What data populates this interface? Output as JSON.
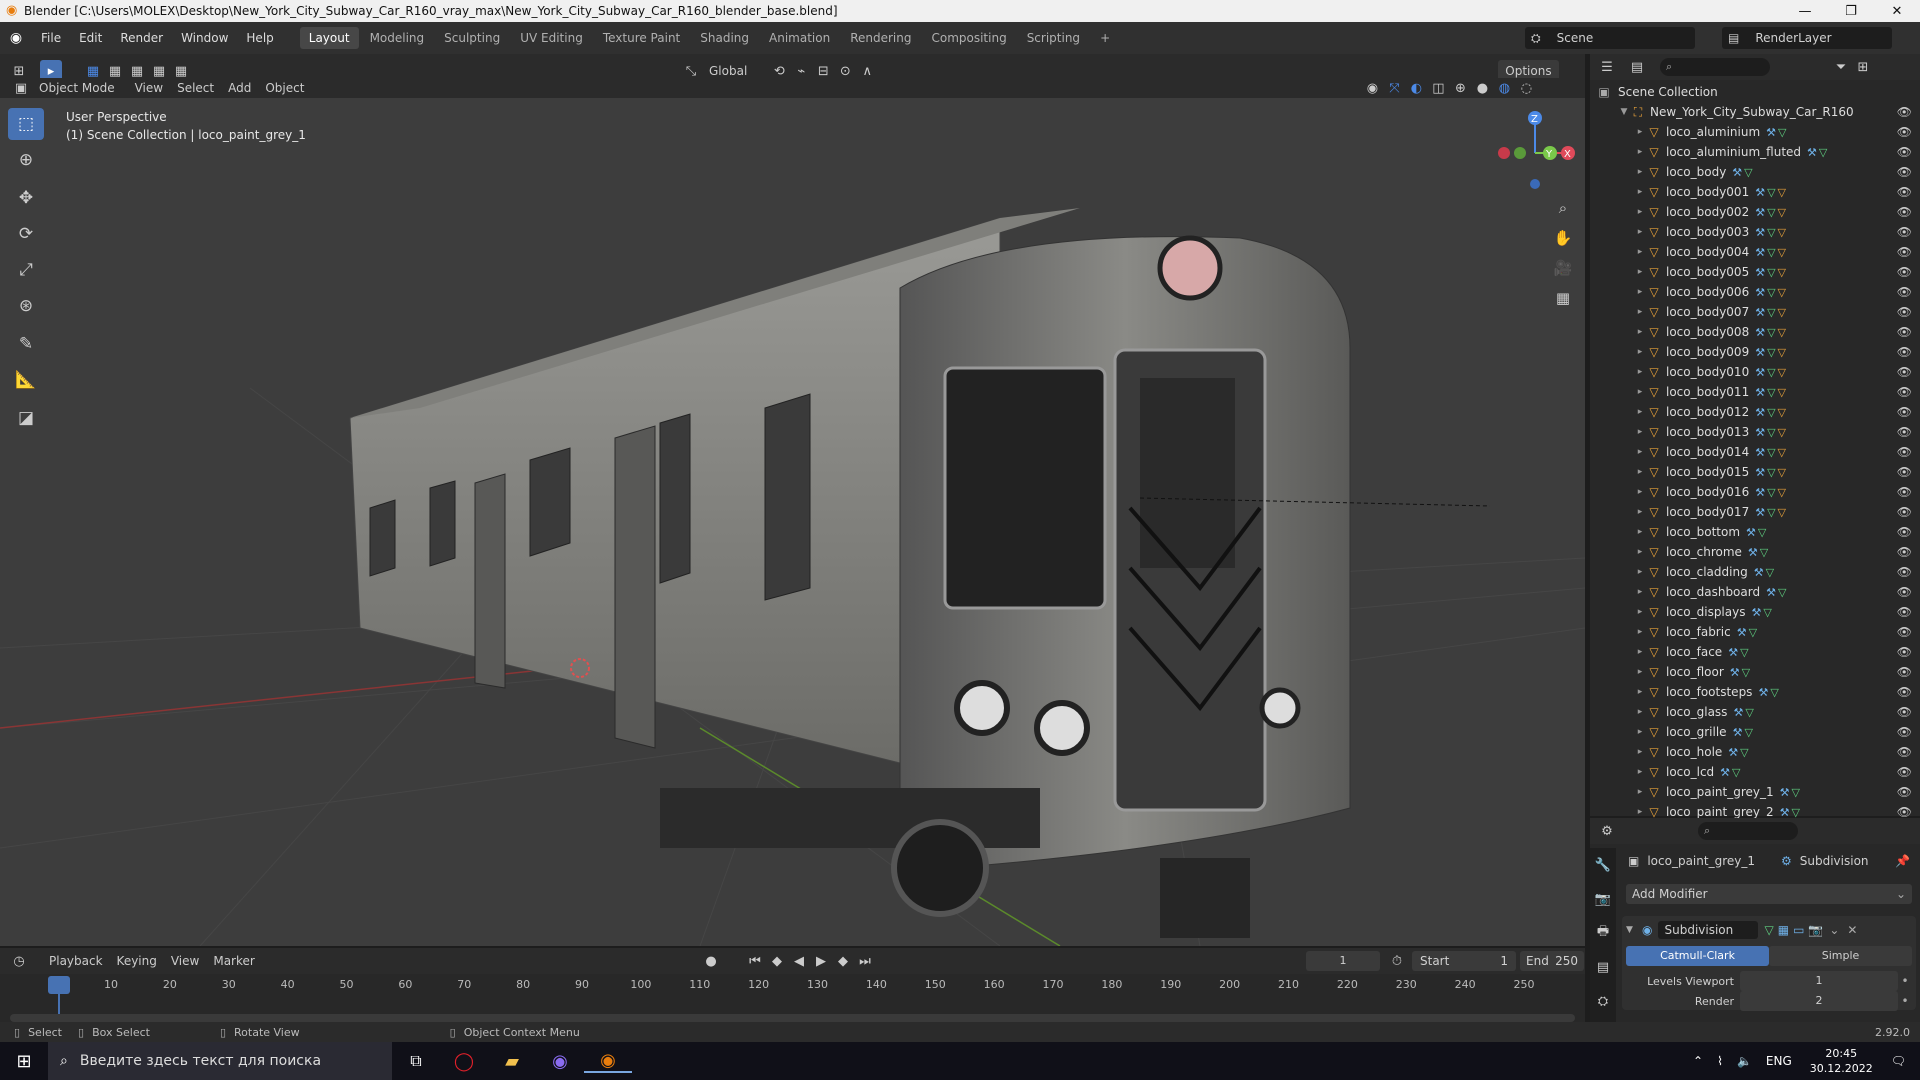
{
  "window": {
    "title": "Blender [C:\\Users\\MOLEX\\Desktop\\New_York_City_Subway_Car_R160_vray_max\\New_York_City_Subway_Car_R160_blender_base.blend]",
    "minimize": "—",
    "maximize": "❐",
    "close": "✕"
  },
  "menu": [
    "File",
    "Edit",
    "Render",
    "Window",
    "Help"
  ],
  "workspaces": [
    "Layout",
    "Modeling",
    "Sculpting",
    "UV Editing",
    "Texture Paint",
    "Shading",
    "Animation",
    "Rendering",
    "Compositing",
    "Scripting"
  ],
  "workspace_add": "+",
  "scene": {
    "label": "Scene",
    "renderlayer": "RenderLayer"
  },
  "viewport_header": {
    "mode": "Object Mode",
    "view": "View",
    "select": "Select",
    "add": "Add",
    "object": "Object",
    "orientation": "Global",
    "options": "Options"
  },
  "viewport_info": {
    "line1": "User Perspective",
    "line2": "(1) Scene Collection | loco_paint_grey_1"
  },
  "gizmo": {
    "z": "Z",
    "y": "Y",
    "x": "X"
  },
  "outliner": {
    "root": "Scene Collection",
    "collection": "New_York_City_Subway_Car_R160",
    "items": [
      {
        "name": "loco_aluminium",
        "mods": "m"
      },
      {
        "name": "loco_aluminium_fluted",
        "mods": "m"
      },
      {
        "name": "loco_body",
        "mods": "m"
      },
      {
        "name": "loco_body001",
        "mods": "mo"
      },
      {
        "name": "loco_body002",
        "mods": "mo"
      },
      {
        "name": "loco_body003",
        "mods": "mo"
      },
      {
        "name": "loco_body004",
        "mods": "mo"
      },
      {
        "name": "loco_body005",
        "mods": "mo"
      },
      {
        "name": "loco_body006",
        "mods": "mo"
      },
      {
        "name": "loco_body007",
        "mods": "mo"
      },
      {
        "name": "loco_body008",
        "mods": "mo"
      },
      {
        "name": "loco_body009",
        "mods": "mo"
      },
      {
        "name": "loco_body010",
        "mods": "mo"
      },
      {
        "name": "loco_body011",
        "mods": "mo"
      },
      {
        "name": "loco_body012",
        "mods": "mo"
      },
      {
        "name": "loco_body013",
        "mods": "mo"
      },
      {
        "name": "loco_body014",
        "mods": "mo"
      },
      {
        "name": "loco_body015",
        "mods": "mo"
      },
      {
        "name": "loco_body016",
        "mods": "mo"
      },
      {
        "name": "loco_body017",
        "mods": "mo"
      },
      {
        "name": "loco_bottom",
        "mods": "m"
      },
      {
        "name": "loco_chrome",
        "mods": "m"
      },
      {
        "name": "loco_cladding",
        "mods": "m"
      },
      {
        "name": "loco_dashboard",
        "mods": "m"
      },
      {
        "name": "loco_displays",
        "mods": "m"
      },
      {
        "name": "loco_fabric",
        "mods": "m"
      },
      {
        "name": "loco_face",
        "mods": "m"
      },
      {
        "name": "loco_floor",
        "mods": "m"
      },
      {
        "name": "loco_footsteps",
        "mods": "m"
      },
      {
        "name": "loco_glass",
        "mods": "m"
      },
      {
        "name": "loco_grille",
        "mods": "m"
      },
      {
        "name": "loco_hole",
        "mods": "m"
      },
      {
        "name": "loco_lcd",
        "mods": "m"
      },
      {
        "name": "loco_paint_grey_1",
        "mods": "m"
      },
      {
        "name": "loco_paint_grey_2",
        "mods": "m"
      }
    ]
  },
  "properties": {
    "object": "loco_paint_grey_1",
    "modifier_tab": "Subdivision",
    "add_modifier": "Add Modifier",
    "modifier_name": "Subdivision",
    "mode_a": "Catmull-Clark",
    "mode_b": "Simple",
    "levels_label": "Levels Viewport",
    "levels_value": "1",
    "render_label": "Render",
    "render_value": "2"
  },
  "timeline": {
    "playback": "Playback",
    "keying": "Keying",
    "view": "View",
    "marker": "Marker",
    "current_frame": "1",
    "start_label": "Start",
    "start": "1",
    "end_label": "End",
    "end": "250",
    "ticks": [
      "1",
      "10",
      "20",
      "30",
      "40",
      "50",
      "60",
      "70",
      "80",
      "90",
      "100",
      "110",
      "120",
      "130",
      "140",
      "150",
      "160",
      "170",
      "180",
      "190",
      "200",
      "210",
      "220",
      "230",
      "240",
      "250"
    ]
  },
  "status": {
    "select": "Select",
    "box_select": "Box Select",
    "rotate": "Rotate View",
    "context": "Object Context Menu",
    "version": "2.92.0"
  },
  "taskbar": {
    "search": "Введите здесь текст для поиска",
    "lang": "ENG",
    "time": "20:45",
    "date": "30.12.2022"
  }
}
